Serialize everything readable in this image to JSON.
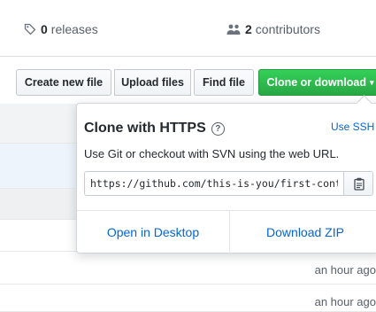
{
  "stats": {
    "releases_count": "0",
    "releases_label": "releases",
    "releases_icon": "tag-icon",
    "contributors_count": "2",
    "contributors_label": "contributors",
    "contributors_icon": "people-icon"
  },
  "toolbar": {
    "create_file": "Create new file",
    "upload_files": "Upload files",
    "find_file": "Find file",
    "clone_download": "Clone or download",
    "clone_caret": "▾"
  },
  "file_list": {
    "timestamps": [
      "an hour ago",
      "an hour ago"
    ]
  },
  "clone_popover": {
    "title": "Clone with HTTPS",
    "help_icon": "question-icon",
    "help_glyph": "?",
    "use_ssh": "Use SSH",
    "description": "Use Git or checkout with SVN using the web URL.",
    "url": "https://github.com/this-is-you/first-contributions.git",
    "copy_icon": "clipboard-icon",
    "open_desktop": "Open in Desktop",
    "download_zip": "Download ZIP"
  },
  "colors": {
    "accent_blue": "#0366d6",
    "clone_green": "#28a745"
  }
}
